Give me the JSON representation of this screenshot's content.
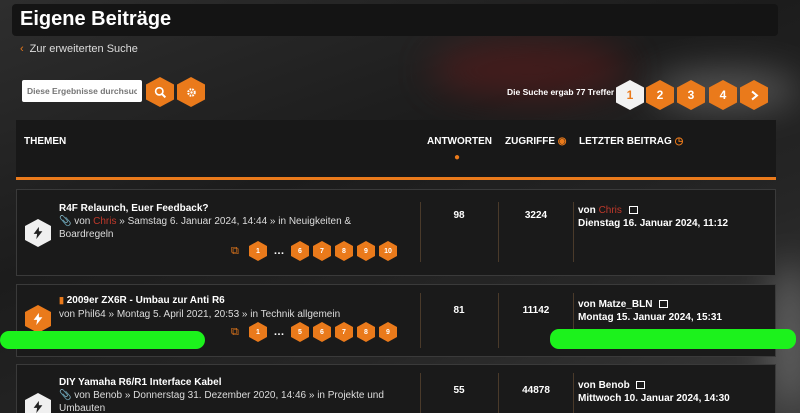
{
  "page": {
    "title": "Eigene Beiträge",
    "back_link": "Zur erweiterten Suche"
  },
  "search": {
    "placeholder": "Diese Ergebnisse durchsuchen",
    "result_text": "Die Suche ergab 77 Treffer"
  },
  "pagination": {
    "pages": [
      "1",
      "2",
      "3",
      "4"
    ],
    "current": "1",
    "next_icon": "chevron-right-icon"
  },
  "table_header": {
    "topics": "THEMEN",
    "replies": "ANTWORTEN",
    "views": "ZUGRIFFE",
    "last_post": "LETZTER BEITRAG"
  },
  "topics": [
    {
      "title": "R4F Relaunch, Euer Feedback?",
      "author": "Chris",
      "date_location": "» Samstag 6. Januar 2024, 14:44 » in Neuigkeiten & Boardregeln",
      "pages": [
        "1",
        "6",
        "7",
        "8",
        "9",
        "10"
      ],
      "replies": "98",
      "views": "3224",
      "last_author": "Chris",
      "last_date": "Dienstag 16. Januar 2024, 11:12"
    },
    {
      "title": "2009er ZX6R - Umbau zur Anti R6",
      "author": "Phil64",
      "date_location": "» Montag 5. April 2021, 20:53 » in Technik allgemein",
      "pages": [
        "1",
        "5",
        "6",
        "7",
        "8",
        "9"
      ],
      "replies": "81",
      "views": "11142",
      "last_author": "Matze_BLN",
      "last_date": "Montag 15. Januar 2024, 15:31"
    },
    {
      "title": "DIY Yamaha R6/R1 Interface Kabel",
      "author": "Benob",
      "date_location": "» Donnerstag 31. Dezember 2020, 14:46 » in Projekte und Umbauten",
      "replies": "55",
      "views": "44878",
      "last_author": "Benob",
      "last_date": "Mittwoch 10. Januar 2024, 14:30"
    }
  ],
  "labels": {
    "von": "von",
    "ellipsis": "…"
  },
  "colors": {
    "accent": "#ea7a1b",
    "author_red": "#c0392b",
    "highlight": "#1cf21c"
  }
}
